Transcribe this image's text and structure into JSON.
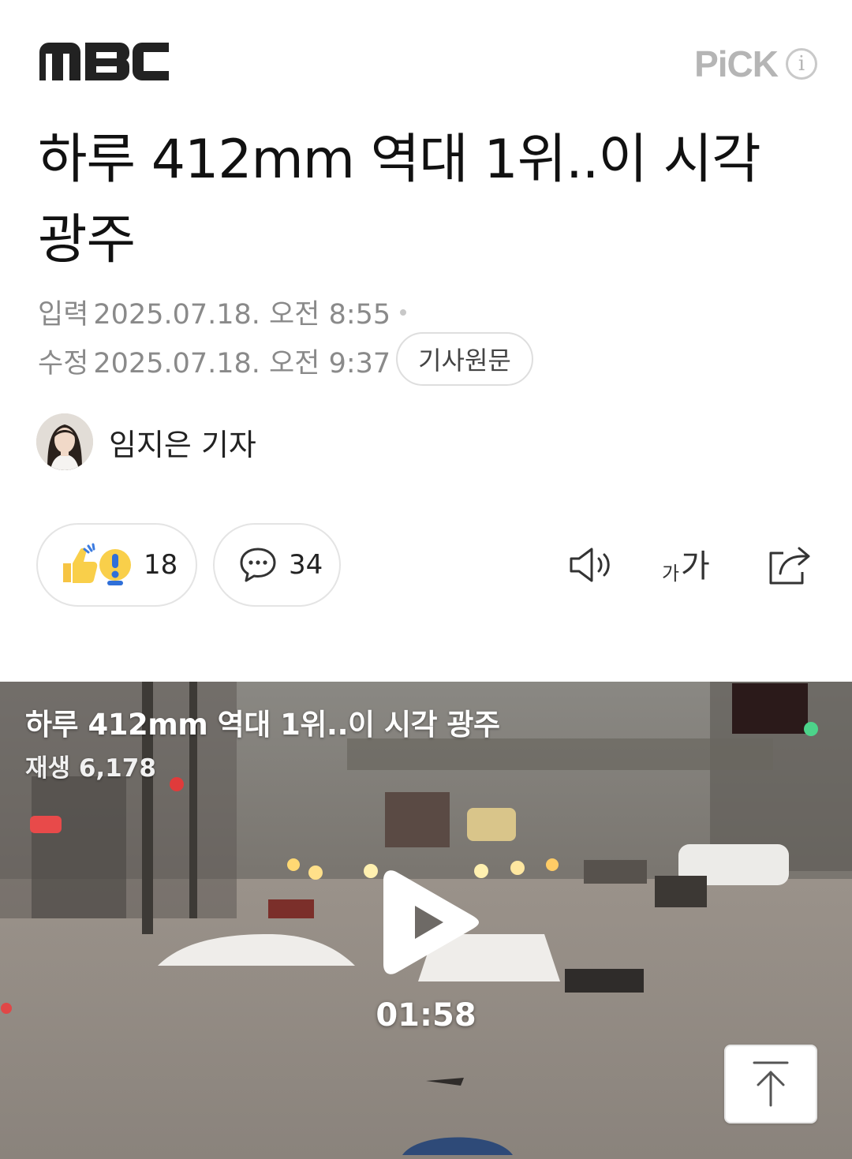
{
  "header": {
    "logo_text": "MBC",
    "pick_label": "PiCK",
    "info_glyph": "i"
  },
  "article": {
    "title": "하루 412mm 역대 1위..이 시각 광주",
    "input_label": "입력",
    "input_datetime": "2025.07.18. 오전 8:55",
    "edit_label": "수정",
    "edit_datetime": "2025.07.18. 오전 9:37",
    "original_button": "기사원문",
    "reporter": "임지은 기자"
  },
  "actions": {
    "reaction_count": "18",
    "comment_count": "34",
    "speak_icon": "speaker-icon",
    "font_icon": "font-size-icon",
    "share_icon": "share-icon"
  },
  "video": {
    "title": "하루 412mm 역대 1위..이 시각 광주",
    "plays": "재생 6,178",
    "duration": "01:58"
  }
}
